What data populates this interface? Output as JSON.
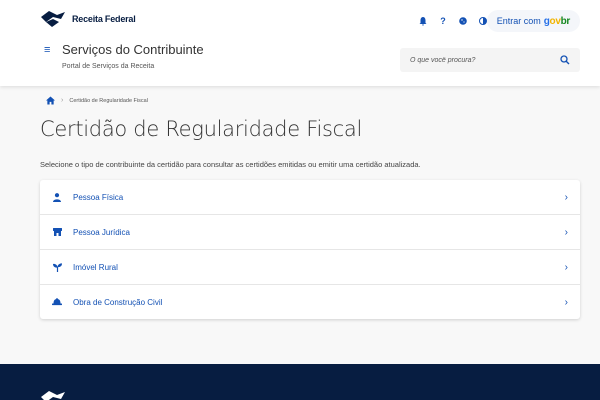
{
  "header": {
    "brand_name": "Receita Federal",
    "site_title": "Serviços do Contribuinte",
    "site_subtitle": "Portal de Serviços da Receita",
    "icons": [
      "bell-icon",
      "help-icon",
      "cookie-icon",
      "contrast-icon"
    ],
    "login": {
      "prefix": "Entrar com",
      "govbr": [
        "g",
        "ov",
        "br"
      ]
    },
    "search": {
      "placeholder": "O que você procura?"
    }
  },
  "breadcrumb": {
    "current": "Certidão de Regularidade Fiscal"
  },
  "page": {
    "title": "Certidão de Regularidade Fiscal",
    "description": "Selecione o tipo de contribuinte da certidão para consultar as certidões emitidas ou emitir uma certidão atualizada."
  },
  "options": [
    {
      "label": "Pessoa Física",
      "icon": "person-icon"
    },
    {
      "label": "Pessoa Jurídica",
      "icon": "store-icon"
    },
    {
      "label": "Imóvel Rural",
      "icon": "plant-icon"
    },
    {
      "label": "Obra de Construção Civil",
      "icon": "construction-icon"
    }
  ],
  "colors": {
    "primary": "#1351b4",
    "footer": "#071d41",
    "brand": "#071d41"
  }
}
